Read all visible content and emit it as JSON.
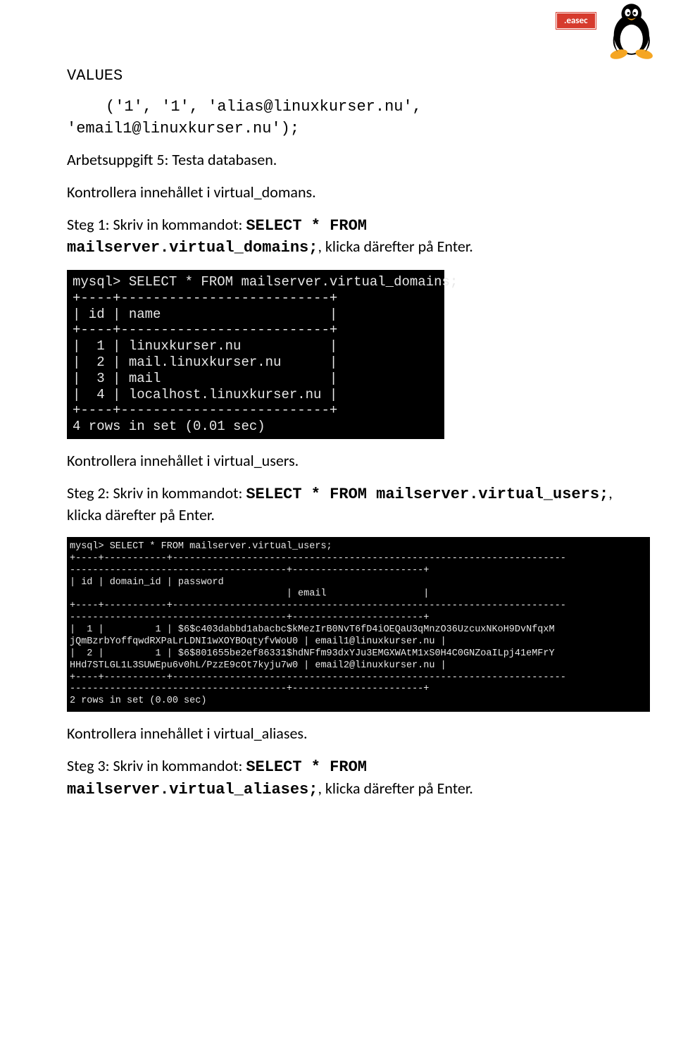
{
  "logo": {
    "badge": ".easec"
  },
  "values": {
    "heading": "VALUES",
    "line1": "('1', '1', 'alias@linuxkurser.nu',",
    "line2": "'email1@linuxkurser.nu');"
  },
  "task_heading": "Arbetsuppgift 5: Testa databasen.",
  "para1": "Kontrollera innehållet i virtual_domans.",
  "step1": {
    "prefix": "Steg 1: Skriv in kommandot: ",
    "cmd": "SELECT * FROM mailserver.virtual_domains;",
    "suffix": ", klicka därefter på Enter."
  },
  "term1": "mysql> SELECT * FROM mailserver.virtual_domains;\n+----+--------------------------+\n| id | name                     |\n+----+--------------------------+\n|  1 | linuxkurser.nu           |\n|  2 | mail.linuxkurser.nu      |\n|  3 | mail                     |\n|  4 | localhost.linuxkurser.nu |\n+----+--------------------------+\n4 rows in set (0.01 sec)",
  "para2": "Kontrollera innehållet i virtual_users.",
  "step2": {
    "prefix": "Steg 2: Skriv in kommandot: ",
    "cmd": "SELECT * FROM mailserver.virtual_users;",
    "suffix": ", klicka därefter på Enter."
  },
  "term2": "mysql> SELECT * FROM mailserver.virtual_users;\n+----+-----------+---------------------------------------------------------------------\n--------------------------------------+-----------------------+\n| id | domain_id | password\n                                      | email                 |\n+----+-----------+---------------------------------------------------------------------\n--------------------------------------+-----------------------+\n|  1 |         1 | $6$c403dabbd1abacbc$kMezIrB0NvT6fD4iOEQaU3qMnzO36UzcuxNKoH9DvNfqxM\njQmBzrbYoffqwdRXPaLrLDNI1wXOYBOqtyfvWoU0 | email1@linuxkurser.nu |\n|  2 |         1 | $6$801655be2ef86331$hdNFfm93dxYJu3EMGXWAtM1xS0H4C0GNZoaILpj41eMFrY\nHHd7STLGL1L3SUWEpu6v0hL/PzzE9cOt7kyju7w0 | email2@linuxkurser.nu |\n+----+-----------+---------------------------------------------------------------------\n--------------------------------------+-----------------------+\n2 rows in set (0.00 sec)",
  "para3": "Kontrollera innehållet i virtual_aliases.",
  "step3": {
    "prefix": "Steg 3: Skriv in kommandot: ",
    "cmd": "SELECT * FROM mailserver.virtual_aliases;",
    "suffix": ", klicka därefter på Enter."
  }
}
